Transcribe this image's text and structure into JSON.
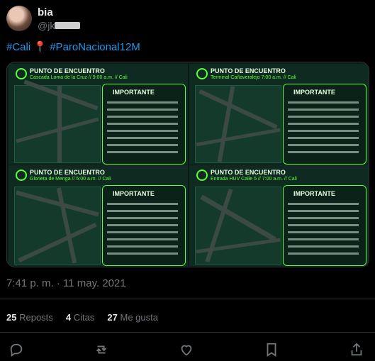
{
  "author": {
    "name": "bia",
    "handle": "@jk"
  },
  "tweet": {
    "text_a": "#Cali",
    "pin": "📍",
    "text_b": "#ParoNacional12M"
  },
  "media": {
    "panels": [
      {
        "title": "PUNTO DE ENCUENTRO",
        "sub": "Cascada Loma de la Cruz // 9:00 a.m. // Cali",
        "box": "IMPORTANTE"
      },
      {
        "title": "PUNTO DE ENCUENTRO",
        "sub": "Terminal Cañaveralejo 7:00 a.m. // Cali",
        "box": "IMPORTANTE"
      },
      {
        "title": "PUNTO DE ENCUENTRO",
        "sub": "Glorieta de Menga // 5:00 a.m. // Cali",
        "box": "IMPORTANTE"
      },
      {
        "title": "PUNTO DE ENCUENTRO",
        "sub": "Entrada HUV Calle 5 // 7:00 a.m. // Cali",
        "box": "IMPORTANTE"
      }
    ]
  },
  "meta": {
    "timestamp": "7:41 p. m. · 11 may. 2021"
  },
  "stats": {
    "reposts_count": "25",
    "reposts_label": "Reposts",
    "quotes_count": "4",
    "quotes_label": "Citas",
    "likes_count": "27",
    "likes_label": "Me gusta"
  },
  "icons": {
    "reply": "reply-icon",
    "repost": "repost-icon",
    "like": "heart-icon",
    "bookmark": "bookmark-icon",
    "share": "share-icon"
  },
  "colors": {
    "accent": "#1d9bf0",
    "green": "#5cff3a",
    "muted": "#71767b"
  }
}
